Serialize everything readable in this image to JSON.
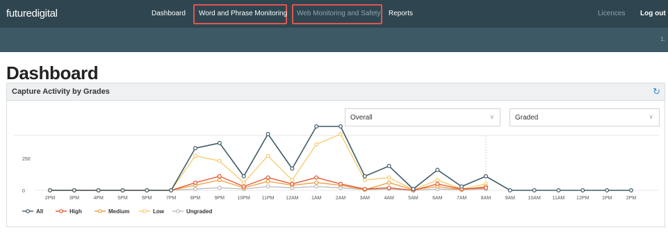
{
  "app": {
    "logo": "futuredigital"
  },
  "nav": {
    "items": [
      {
        "label": "Dashboard",
        "dim": false,
        "highlight": false
      },
      {
        "label": "Word and Phrase Monitoring",
        "dim": false,
        "highlight": true
      },
      {
        "label": "Web Monitoring and Safety",
        "dim": true,
        "highlight": true
      },
      {
        "label": "Reports",
        "dim": false,
        "highlight": false
      }
    ],
    "licences": "Licences",
    "logout": "Log out"
  },
  "subbar": {
    "text": "1."
  },
  "page": {
    "title": "Dashboard"
  },
  "panel": {
    "title": "Capture Activity by Grades",
    "refresh_icon": "refresh-icon",
    "filters": {
      "scope": "Overall",
      "grade": "Graded"
    }
  },
  "colors": {
    "topbar": "#2f4650",
    "subbar": "#3d5965",
    "highlight": "#e05650",
    "accent": "#2f8fd0"
  },
  "chart_data": {
    "type": "line",
    "x": [
      "2PM",
      "3PM",
      "4PM",
      "5PM",
      "6PM",
      "7PM",
      "8PM",
      "9PM",
      "10PM",
      "11PM",
      "12AM",
      "1AM",
      "2AM",
      "3AM",
      "4AM",
      "5AM",
      "6AM",
      "7AM",
      "8AM",
      "9AM",
      "10AM",
      "11AM",
      "12PM",
      "1PM",
      "2PM"
    ],
    "yticks": [
      0,
      250
    ],
    "ylim": [
      0,
      500
    ],
    "grid": false,
    "legend_position": "bottom-left",
    "series": [
      {
        "name": "All",
        "color": "#3e5a66",
        "values": [
          0,
          0,
          0,
          0,
          0,
          0,
          330,
          370,
          110,
          440,
          170,
          500,
          500,
          110,
          190,
          10,
          160,
          30,
          110,
          0,
          0,
          0,
          0,
          0,
          0
        ]
      },
      {
        "name": "High",
        "color": "#e0502a",
        "values": [
          0,
          0,
          0,
          0,
          0,
          0,
          60,
          110,
          30,
          100,
          50,
          100,
          50,
          10,
          20,
          0,
          50,
          10,
          20,
          null,
          null,
          null,
          null,
          null,
          null
        ]
      },
      {
        "name": "Medium",
        "color": "#f29a38",
        "values": [
          0,
          0,
          0,
          0,
          0,
          0,
          40,
          80,
          20,
          70,
          40,
          60,
          40,
          5,
          60,
          5,
          30,
          5,
          30,
          null,
          null,
          null,
          null,
          null,
          null
        ]
      },
      {
        "name": "Low",
        "color": "#f7c96a",
        "values": [
          0,
          0,
          0,
          0,
          0,
          0,
          270,
          230,
          60,
          270,
          80,
          360,
          440,
          80,
          100,
          5,
          80,
          10,
          50,
          null,
          null,
          null,
          null,
          null,
          null
        ]
      },
      {
        "name": "Ungraded",
        "color": "#b9b9b9",
        "values": [
          0,
          0,
          0,
          0,
          0,
          0,
          10,
          20,
          10,
          30,
          20,
          30,
          20,
          5,
          10,
          0,
          10,
          5,
          10,
          null,
          null,
          null,
          null,
          null,
          null
        ]
      }
    ]
  }
}
